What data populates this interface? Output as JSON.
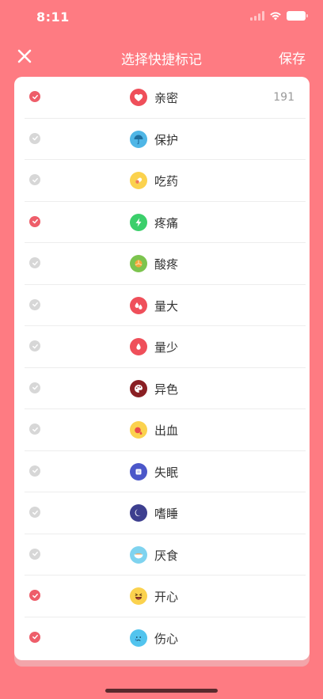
{
  "status_bar": {
    "time": "8:11"
  },
  "nav": {
    "close_icon": "close-icon",
    "title": "选择快捷标记",
    "save_label": "保存"
  },
  "items": [
    {
      "label": "亲密",
      "checked": true,
      "count": "191",
      "icon": "heart-icon",
      "color": "#ef4f5a"
    },
    {
      "label": "保护",
      "checked": false,
      "count": "",
      "icon": "umbrella-icon",
      "color": "#4fb6e6"
    },
    {
      "label": "吃药",
      "checked": false,
      "count": "",
      "icon": "pill-icon",
      "color": "#fbd24e"
    },
    {
      "label": "疼痛",
      "checked": true,
      "count": "",
      "icon": "lightning-icon",
      "color": "#3bcf6b"
    },
    {
      "label": "酸疼",
      "checked": false,
      "count": "",
      "icon": "citrus-icon",
      "color": "#7cc44e"
    },
    {
      "label": "量大",
      "checked": false,
      "count": "",
      "icon": "drops-icon",
      "color": "#ef4f5a"
    },
    {
      "label": "量少",
      "checked": false,
      "count": "",
      "icon": "drop-icon",
      "color": "#ef4f5a"
    },
    {
      "label": "异色",
      "checked": false,
      "count": "",
      "icon": "palette-icon",
      "color": "#8a1f23"
    },
    {
      "label": "出血",
      "checked": false,
      "count": "",
      "icon": "bleeding-icon",
      "color": "#fbd24e"
    },
    {
      "label": "失眠",
      "checked": false,
      "count": "",
      "icon": "square-icon",
      "color": "#4b57c9"
    },
    {
      "label": "嗜睡",
      "checked": false,
      "count": "",
      "icon": "moon-icon",
      "color": "#3d3f8f"
    },
    {
      "label": "厌食",
      "checked": false,
      "count": "",
      "icon": "bowl-icon",
      "color": "#7fd3ef"
    },
    {
      "label": "开心",
      "checked": true,
      "count": "",
      "icon": "laughing-face-icon",
      "color": "#fbd24e"
    },
    {
      "label": "伤心",
      "checked": true,
      "count": "",
      "icon": "sad-face-icon",
      "color": "#52c4ee"
    }
  ]
}
